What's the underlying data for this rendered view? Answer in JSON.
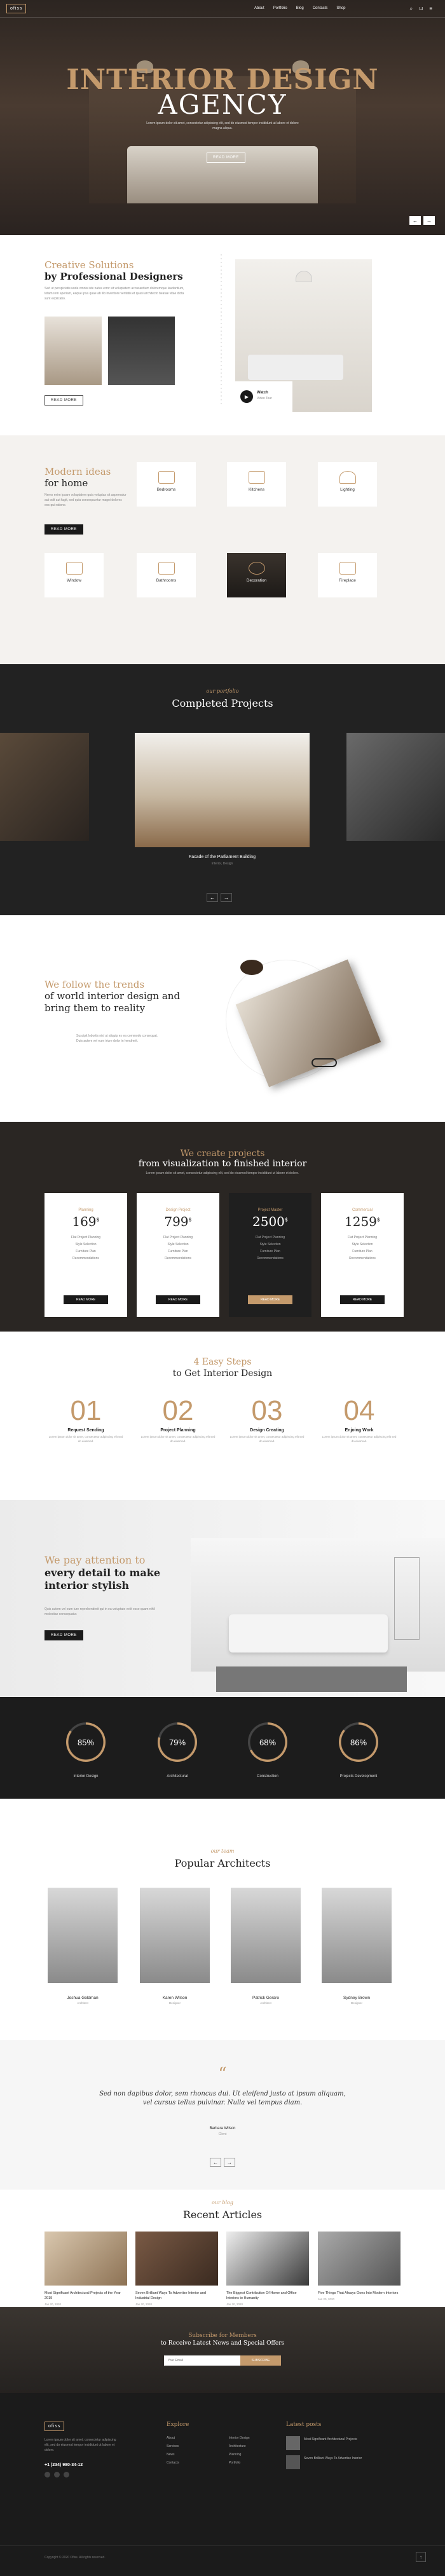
{
  "nav": {
    "logo": "ofiss",
    "links": [
      "About",
      "Portfolio",
      "Blog",
      "Contacts",
      "Shop"
    ],
    "icons": [
      "search-icon",
      "cart-icon",
      "menu-icon"
    ]
  },
  "hero": {
    "title_line1": "INTERIOR DESIGN",
    "title_line2": "AGENCY",
    "text": "Lorem ipsum dolor sit amet, consectetur adipiscing elit, sed do eiusmod tempor incididunt ut labore et dolore magna aliqua.",
    "button": "READ MORE",
    "prev": "←",
    "next": "→"
  },
  "creative": {
    "title_gold": "Creative Solutions",
    "title": "by Professional Designers",
    "text": "Sed ut perspiciatis unde omnis iste natus error sit voluptatem accusantium doloremque laudantium, totam rem aperiam, eaque ipsa quae ab illo inventore veritatis et quasi architecto beatae vitae dicta sunt explicabo.",
    "button": "READ MORE",
    "video_title": "Watch",
    "video_sub": "Video Tour"
  },
  "ideas": {
    "title_gold": "Modern ideas",
    "title": "for home",
    "text": "Nemo enim ipsam voluptatem quia voluptas sit aspernatur aut odit aut fugit, sed quia consequuntur magni dolores eos qui ratione.",
    "button": "READ MORE",
    "cards": [
      {
        "label": "Bedrooms",
        "icon": "bed-icon"
      },
      {
        "label": "Kitchens",
        "icon": "kitchen-icon"
      },
      {
        "label": "Lighting",
        "icon": "lamp-icon"
      },
      {
        "label": "Window",
        "icon": "window-icon"
      },
      {
        "label": "Bathrooms",
        "icon": "bathtub-icon"
      },
      {
        "label": "Decoration",
        "icon": "vase-icon"
      },
      {
        "label": "Fireplace",
        "icon": "fireplace-icon"
      }
    ]
  },
  "completed": {
    "script": "our portfolio",
    "title": "Completed Projects",
    "caption": "Facade of the Parliament Building",
    "caption_sub": "Interior, Design",
    "prev": "←",
    "next": "→"
  },
  "trends": {
    "title_gold": "We follow the trends",
    "title": "of world interior design and bring them to reality",
    "text": "Suscipit lobortis nisl ut aliquip ex ea commodo consequat. Duis autem vel eum iriure dolor in hendrerit."
  },
  "pricing": {
    "title_gold": "We create projects",
    "title": "from visualization to finished interior",
    "text": "Lorem ipsum dolor sit amet, consectetur adipiscing elit, sed do eiusmod tempor incididunt ut labore et dolore.",
    "plans": [
      {
        "name": "Planning",
        "price": "169",
        "currency": "$",
        "features": [
          "Flat Project Planning",
          "Style Selection",
          "Furniture Plan",
          "Recommendations"
        ],
        "button": "READ MORE"
      },
      {
        "name": "Design Project",
        "price": "799",
        "currency": "$",
        "features": [
          "Flat Project Planning",
          "Style Selection",
          "Furniture Plan",
          "Recommendations"
        ],
        "button": "READ MORE"
      },
      {
        "name": "Project Master",
        "price": "2500",
        "currency": "$",
        "features": [
          "Flat Project Planning",
          "Style Selection",
          "Furniture Plan",
          "Recommendations"
        ],
        "button": "READ MORE"
      },
      {
        "name": "Commercial",
        "price": "1259",
        "currency": "$",
        "features": [
          "Flat Project Planning",
          "Style Selection",
          "Furniture Plan",
          "Recommendations"
        ],
        "button": "READ MORE"
      }
    ]
  },
  "steps": {
    "title_gold": "4 Easy Steps",
    "title": "to Get Interior Design",
    "items": [
      {
        "num": "01",
        "title": "Request Sending",
        "text": "Lorem ipsum dolor sit amet, consectetur adipiscing elit sed do eiusmod."
      },
      {
        "num": "02",
        "title": "Project Planning",
        "text": "Lorem ipsum dolor sit amet, consectetur adipiscing elit sed do eiusmod."
      },
      {
        "num": "03",
        "title": "Design Creating",
        "text": "Lorem ipsum dolor sit amet, consectetur adipiscing elit sed do eiusmod."
      },
      {
        "num": "04",
        "title": "Enjoing Work",
        "text": "Lorem ipsum dolor sit amet, consectetur adipiscing elit sed do eiusmod."
      }
    ]
  },
  "attention": {
    "title_gold": "We pay attention to",
    "title": "every detail to make interior stylish",
    "text": "Quis autem vel eum iure reprehenderit qui in ea voluptate velit esse quam nihil molestiae consequatur.",
    "button": "READ MORE"
  },
  "skills": [
    {
      "value": 85,
      "label": "Interior Design"
    },
    {
      "value": 79,
      "label": "Architectural"
    },
    {
      "value": 68,
      "label": "Construction"
    },
    {
      "value": 86,
      "label": "Projects Development"
    }
  ],
  "architects": {
    "script": "our team",
    "title": "Popular Architects",
    "people": [
      {
        "name": "Joshua Goldman",
        "role": "Architect"
      },
      {
        "name": "Karen Wilson",
        "role": "Designer"
      },
      {
        "name": "Patrick Geraro",
        "role": "Architect"
      },
      {
        "name": "Sydney Brown",
        "role": "Designer"
      }
    ]
  },
  "testimonial": {
    "quote": "Sed non dapibus dolor, sem rhoncus dui. Ut eleifend justo at ipsum aliquam, vel cursus tellus pulvinar. Nulla vel tempus diam.",
    "author": "Barbara Wilson",
    "role": "Client",
    "prev": "←",
    "next": "→"
  },
  "articles": {
    "script": "our blog",
    "title": "Recent Articles",
    "items": [
      {
        "title": "Most Significant Architectural Projects of the Year 2019",
        "meta": "Jan 20, 2020"
      },
      {
        "title": "Seven Brilliant Ways To Advertise Interior and Industrial Design",
        "meta": "Jan 20, 2020"
      },
      {
        "title": "The Biggest Contribution Of Home and Office Interiors to Humanity",
        "meta": "Jan 20, 2020"
      },
      {
        "title": "Five Things That Always Goes Into Modern Interiors",
        "meta": "Jan 20, 2020"
      }
    ]
  },
  "subscribe": {
    "title_gold": "Subscribe for Members",
    "title": "to Receive Latest News and Special Offers",
    "placeholder": "Your Email",
    "button": "SUBSCRIBE"
  },
  "footer": {
    "logo": "ofiss",
    "text": "Lorem ipsum dolor sit amet, consectetur adipiscing elit, sed do eiusmod tempor incididunt ut labore et dolore.",
    "phone": "+1 (234) 980-34-12",
    "explore_title": "Explore",
    "explore_col1": [
      "About",
      "Services",
      "News",
      "Contacts"
    ],
    "explore_col2": [
      "Interior Design",
      "Architecture",
      "Planning",
      "Portfolio"
    ],
    "posts_title": "Latest posts",
    "posts": [
      "Most Significant Architectural Projects",
      "Seven Brilliant Ways To Advertise Interior"
    ],
    "copyright": "Copyright © 2020 Ofiss. All rights reserved."
  },
  "colors": {
    "accent": "#c49a6c",
    "dark": "#1c1c1c"
  }
}
